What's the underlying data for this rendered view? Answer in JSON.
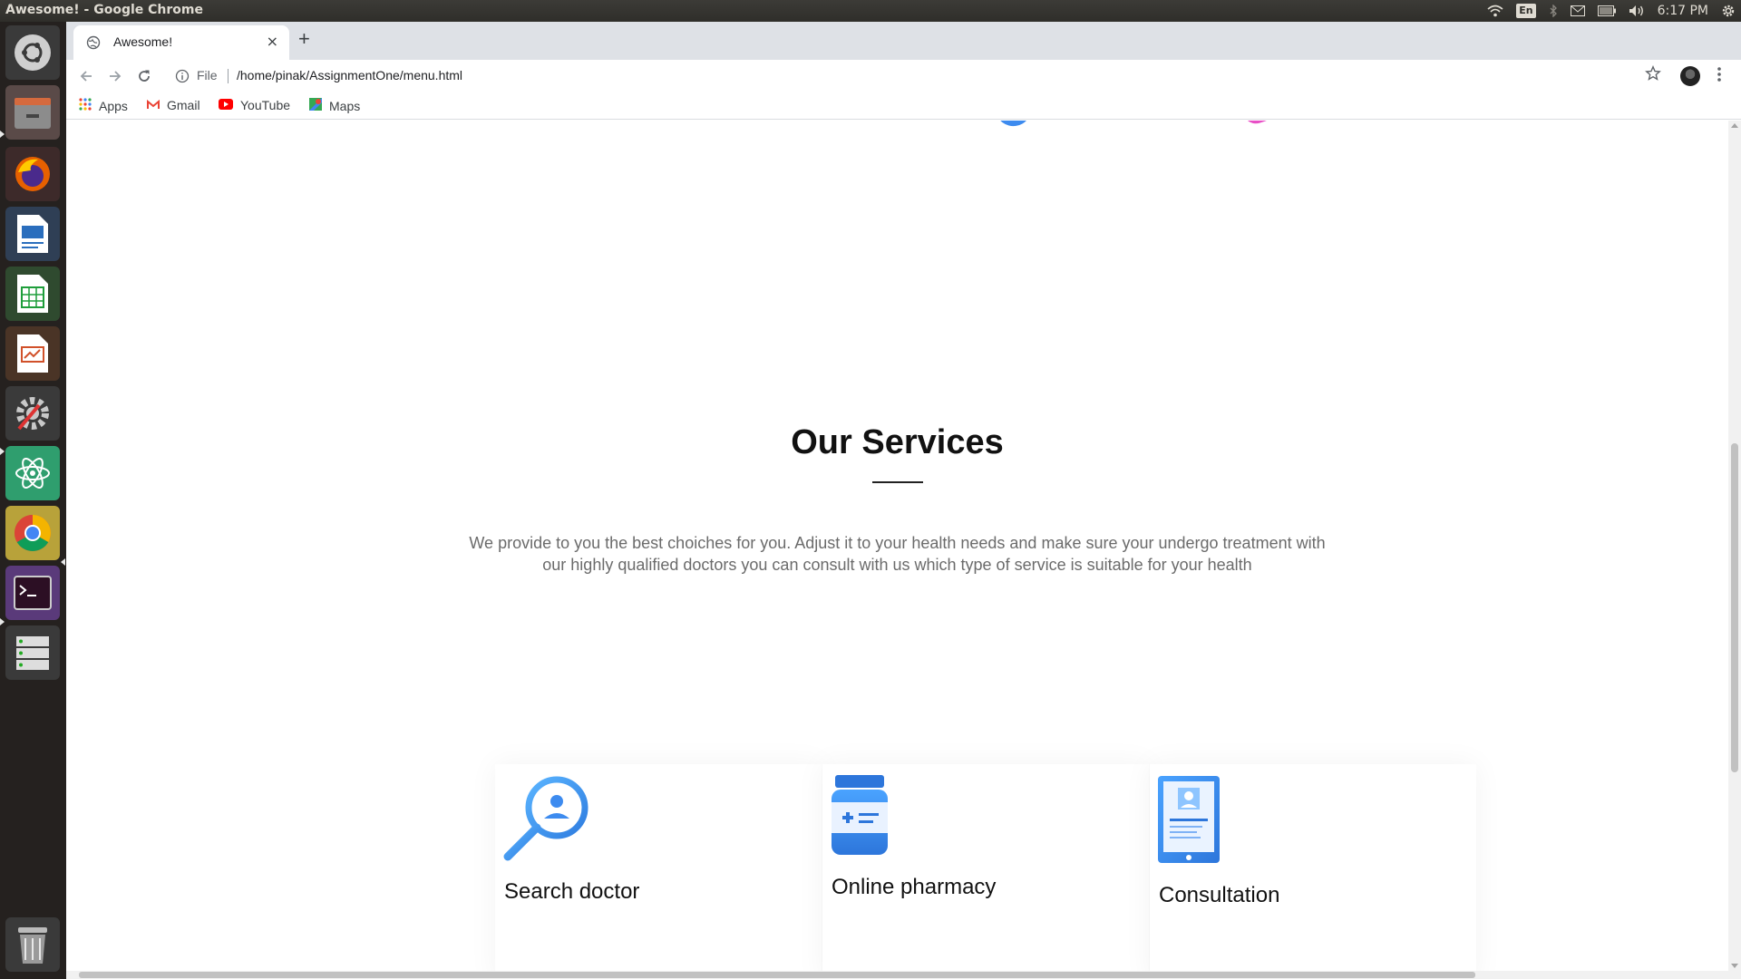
{
  "window_title": "Awesome! - Google Chrome",
  "system_tray": {
    "language": "En",
    "time": "6:17 PM"
  },
  "tab": {
    "title": "Awesome!",
    "close": "×",
    "new_tab": "+"
  },
  "omnibox": {
    "scheme": "File",
    "url": "/home/pinak/AssignmentOne/menu.html"
  },
  "bookmarks": [
    {
      "label": "Apps",
      "icon": "apps-grid-icon"
    },
    {
      "label": "Gmail",
      "icon": "gmail-icon"
    },
    {
      "label": "YouTube",
      "icon": "youtube-icon"
    },
    {
      "label": "Maps",
      "icon": "maps-icon"
    }
  ],
  "launcher": [
    "ubuntu-dash-icon",
    "files-icon",
    "firefox-icon",
    "writer-icon",
    "calc-icon",
    "impress-icon",
    "system-settings-icon",
    "atom-icon",
    "chrome-icon",
    "terminal-icon",
    "server-icon",
    "trash-icon"
  ],
  "services": {
    "title": "Our Services",
    "description": "We provide to you the best choiches for you. Adjust it to your health needs and make sure your undergo treatment with our highly qualified doctors you can consult with us which type of service is suitable for your health",
    "cards": [
      {
        "name": "Search doctor",
        "icon": "search-doctor-icon"
      },
      {
        "name": "Online pharmacy",
        "icon": "pharmacy-bottle-icon"
      },
      {
        "name": "Consultation",
        "icon": "consultation-tablet-icon"
      }
    ]
  },
  "colors": {
    "accent_blue": "#3d8bef",
    "accent_pink": "#e84fc6",
    "ubuntu_panel": "#3c3b37"
  }
}
